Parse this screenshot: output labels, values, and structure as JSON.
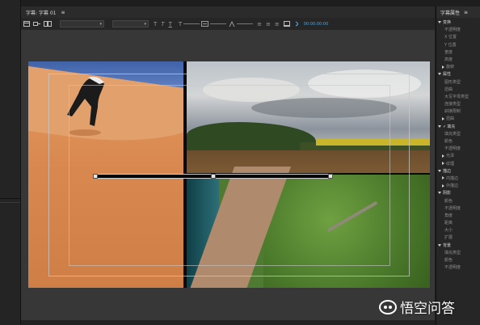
{
  "window": {
    "tab_title": "字幕: 字幕 01",
    "panel_menu": "≡"
  },
  "toolbar": {
    "font_select": "",
    "tools": [
      "T",
      "T",
      "T",
      "T",
      "≡",
      "≡",
      "≡"
    ],
    "timecode": "00:00:00:00"
  },
  "properties": {
    "title": "字幕属性",
    "menu": "≡",
    "items": [
      {
        "label": "变换",
        "kind": "section"
      },
      {
        "label": "不透明度",
        "kind": "prop"
      },
      {
        "label": "X 位置",
        "kind": "prop"
      },
      {
        "label": "Y 位置",
        "kind": "prop"
      },
      {
        "label": "宽度",
        "kind": "prop"
      },
      {
        "label": "高度",
        "kind": "prop"
      },
      {
        "label": "旋转",
        "kind": "sub"
      },
      {
        "label": "属性",
        "kind": "section"
      },
      {
        "label": "图形类型",
        "kind": "prop"
      },
      {
        "label": "扭曲",
        "kind": "prop"
      },
      {
        "label": "大写字母类型",
        "kind": "prop"
      },
      {
        "label": "连接类型",
        "kind": "prop"
      },
      {
        "label": "斜接限制",
        "kind": "prop"
      },
      {
        "label": "扭曲",
        "kind": "sub"
      },
      {
        "label": "填充",
        "kind": "section"
      },
      {
        "label": "填充类型",
        "kind": "prop"
      },
      {
        "label": "颜色",
        "kind": "prop"
      },
      {
        "label": "不透明度",
        "kind": "prop"
      },
      {
        "label": "光泽",
        "kind": "sub"
      },
      {
        "label": "纹理",
        "kind": "sub"
      },
      {
        "label": "描边",
        "kind": "section"
      },
      {
        "label": "内描边",
        "kind": "sub"
      },
      {
        "label": "外描边",
        "kind": "sub"
      },
      {
        "label": "阴影",
        "kind": "section"
      },
      {
        "label": "颜色",
        "kind": "prop"
      },
      {
        "label": "不透明度",
        "kind": "prop"
      },
      {
        "label": "角度",
        "kind": "prop"
      },
      {
        "label": "距离",
        "kind": "prop"
      },
      {
        "label": "大小",
        "kind": "prop"
      },
      {
        "label": "扩展",
        "kind": "prop"
      },
      {
        "label": "背景",
        "kind": "section"
      },
      {
        "label": "填充类型",
        "kind": "prop"
      },
      {
        "label": "颜色",
        "kind": "prop"
      },
      {
        "label": "不透明度",
        "kind": "prop"
      }
    ]
  },
  "watermark": {
    "text": "悟空问答"
  },
  "colors": {
    "accent": "#4aa3df",
    "background": "#1e1e1e",
    "canvas": "#373737"
  }
}
